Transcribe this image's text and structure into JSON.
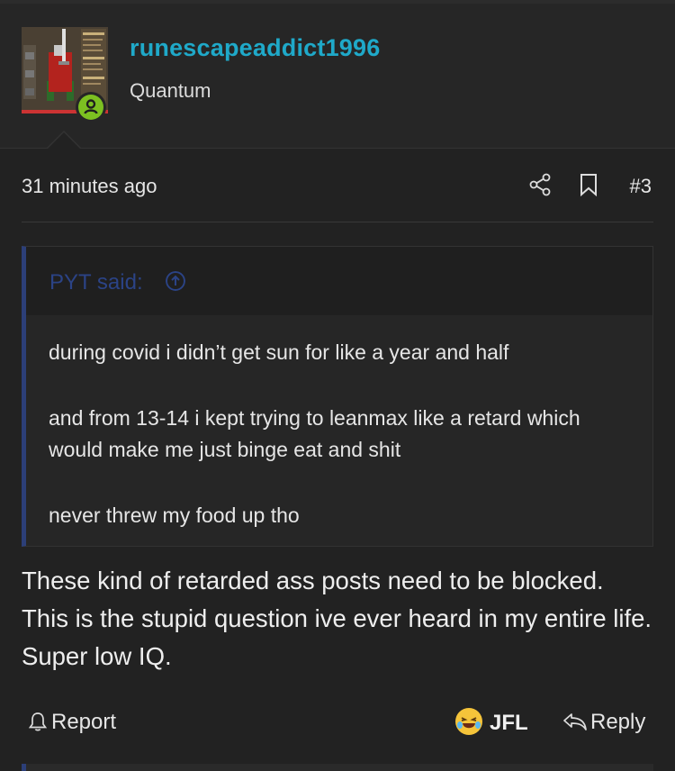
{
  "user": {
    "username": "runescapeaddict1996",
    "title": "Quantum"
  },
  "post": {
    "timestamp": "31 minutes ago",
    "number": "#3",
    "message": "These kind of retarded ass posts need to be blocked. This is the stupid question ive ever heard in my entire life. Super low IQ."
  },
  "quote": {
    "author": "PYT said:",
    "paragraphs": [
      "during covid i didn’t get sun for like a year and half",
      "and from 13-14 i kept trying to leanmax like a retard which would make me just binge eat and shit",
      "never threw my food up tho"
    ]
  },
  "actions": {
    "report": "Report",
    "reaction": "JFL",
    "reply": "Reply"
  },
  "icons": [
    "share-icon",
    "bookmark-icon",
    "arrow-up-circle-icon",
    "bell-icon",
    "laughing-emoji-icon",
    "reply-icon"
  ],
  "colors": {
    "background": "#222222",
    "username": "#1fa9c9",
    "quote_accent": "#2c3f78",
    "online": "#7cc021"
  }
}
